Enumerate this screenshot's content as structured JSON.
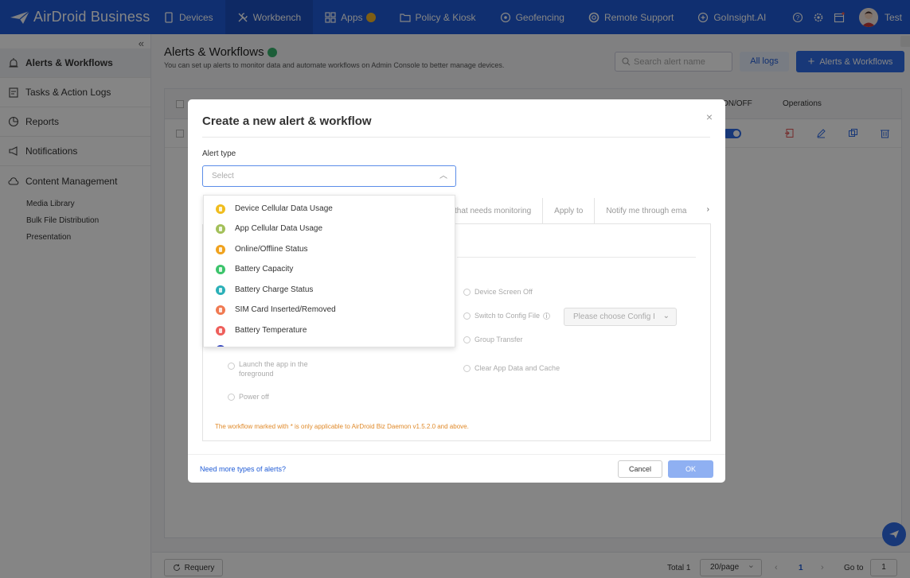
{
  "brand": {
    "name": "AirDroid Business"
  },
  "nav": {
    "items": [
      {
        "label": "Devices",
        "icon": "tablet-icon"
      },
      {
        "label": "Workbench",
        "icon": "tools-icon"
      },
      {
        "label": "Apps",
        "icon": "apps-icon"
      },
      {
        "label": "Policy & Kiosk",
        "icon": "folder-icon"
      },
      {
        "label": "Geofencing",
        "icon": "geofence-icon"
      },
      {
        "label": "Remote Support",
        "icon": "lifebuoy-icon"
      },
      {
        "label": "GoInsight.AI",
        "icon": "ai-icon"
      }
    ],
    "active": "Workbench"
  },
  "user": {
    "name": "Test"
  },
  "sidebar": {
    "items": [
      {
        "label": "Alerts & Workflows",
        "icon": "alarm-icon"
      },
      {
        "label": "Tasks & Action Logs",
        "icon": "clipboard-icon"
      },
      {
        "label": "Reports",
        "icon": "pie-chart-icon"
      },
      {
        "label": "Notifications",
        "icon": "megaphone-icon"
      },
      {
        "label": "Content Management",
        "icon": "cloud-icon"
      }
    ],
    "sub_items": [
      "Media Library",
      "Bulk File Distribution",
      "Presentation"
    ]
  },
  "page": {
    "title": "Alerts & Workflows",
    "description": "You can set up alerts to monitor data and automate workflows on Admin Console to better manage devices.",
    "search_placeholder": "Search alert name",
    "all_logs_label": "All logs",
    "add_label": "Alerts & Workflows"
  },
  "table": {
    "col_onoff": "ON/OFF",
    "col_operations": "Operations"
  },
  "footer": {
    "requery_label": "Requery",
    "total": "Total 1",
    "page_size": "20/page",
    "current_page": "1",
    "goto_label": "Go to",
    "goto_value": "1"
  },
  "modal": {
    "title": "Create a new alert & workflow",
    "alert_type_label": "Alert type",
    "select_placeholder": "Select",
    "steps": [
      "that needs monitoring",
      "Apply to",
      "Notify me through ema"
    ],
    "workflow_options_left": [
      "Launch the app in the foreground",
      "Power off"
    ],
    "workflow_options_right": [
      "Device Screen Off",
      "Switch to Config File",
      "Group Transfer",
      "Clear App Data and Cache"
    ],
    "config_placeholder": "Please choose Config I",
    "note": "The workflow marked with * is only applicable to AirDroid Biz Daemon v1.5.2.0 and above.",
    "more_link": "Need more types of alerts?",
    "cancel_label": "Cancel",
    "ok_label": "OK"
  },
  "dropdown": {
    "items": [
      {
        "label": "Device Cellular Data Usage",
        "color": "#f0bd1e"
      },
      {
        "label": "App Cellular Data Usage",
        "color": "#a3c05a"
      },
      {
        "label": "Online/Offline Status",
        "color": "#f0a21e"
      },
      {
        "label": "Battery Capacity",
        "color": "#3cc46b"
      },
      {
        "label": "Battery Charge Status",
        "color": "#2bb0b8"
      },
      {
        "label": "SIM Card Inserted/Removed",
        "color": "#f07a52"
      },
      {
        "label": "Battery Temperature",
        "color": "#ee5f5b"
      }
    ]
  },
  "colors": {
    "brand_blue": "#1f5bd6",
    "primary_button": "#2e6be6",
    "note_orange": "#e08a2a"
  }
}
